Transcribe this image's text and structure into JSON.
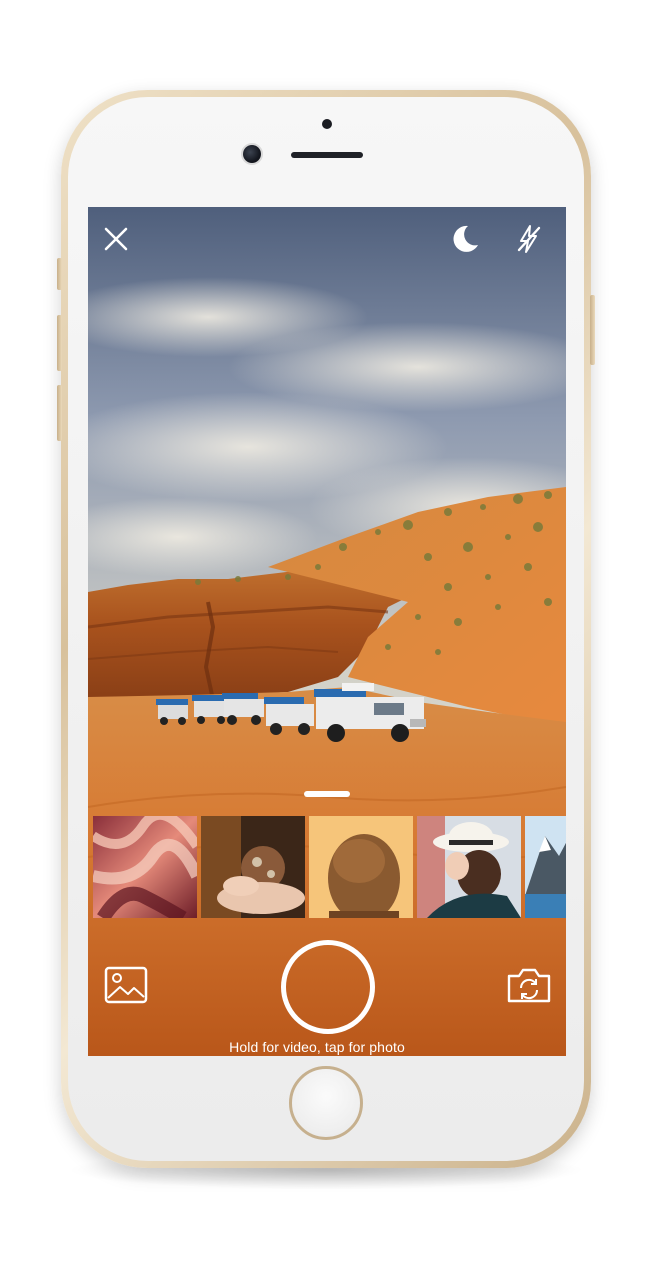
{
  "camera": {
    "top_bar": {
      "close_icon": "close-icon",
      "night_mode_icon": "moon-icon",
      "flash_icon": "flash-off-icon"
    },
    "drawer_handle": "drawer-handle",
    "recent_photos": [
      {
        "name": "thumb-antelope-canyon"
      },
      {
        "name": "thumb-hands-holding-ornament"
      },
      {
        "name": "thumb-person-back-of-head"
      },
      {
        "name": "thumb-person-in-white-hat"
      },
      {
        "name": "thumb-mountain-landscape"
      }
    ],
    "bottom_bar": {
      "gallery_icon": "image-gallery-icon",
      "shutter_icon": "shutter-button",
      "switch_camera_icon": "switch-camera-icon",
      "hint": "Hold for video, tap for photo"
    }
  },
  "colors": {
    "overlay_icon": "#ffffff",
    "sand": "#d77a33",
    "sky": "#7f8fa6",
    "phone_gold": "#d8c19c"
  }
}
